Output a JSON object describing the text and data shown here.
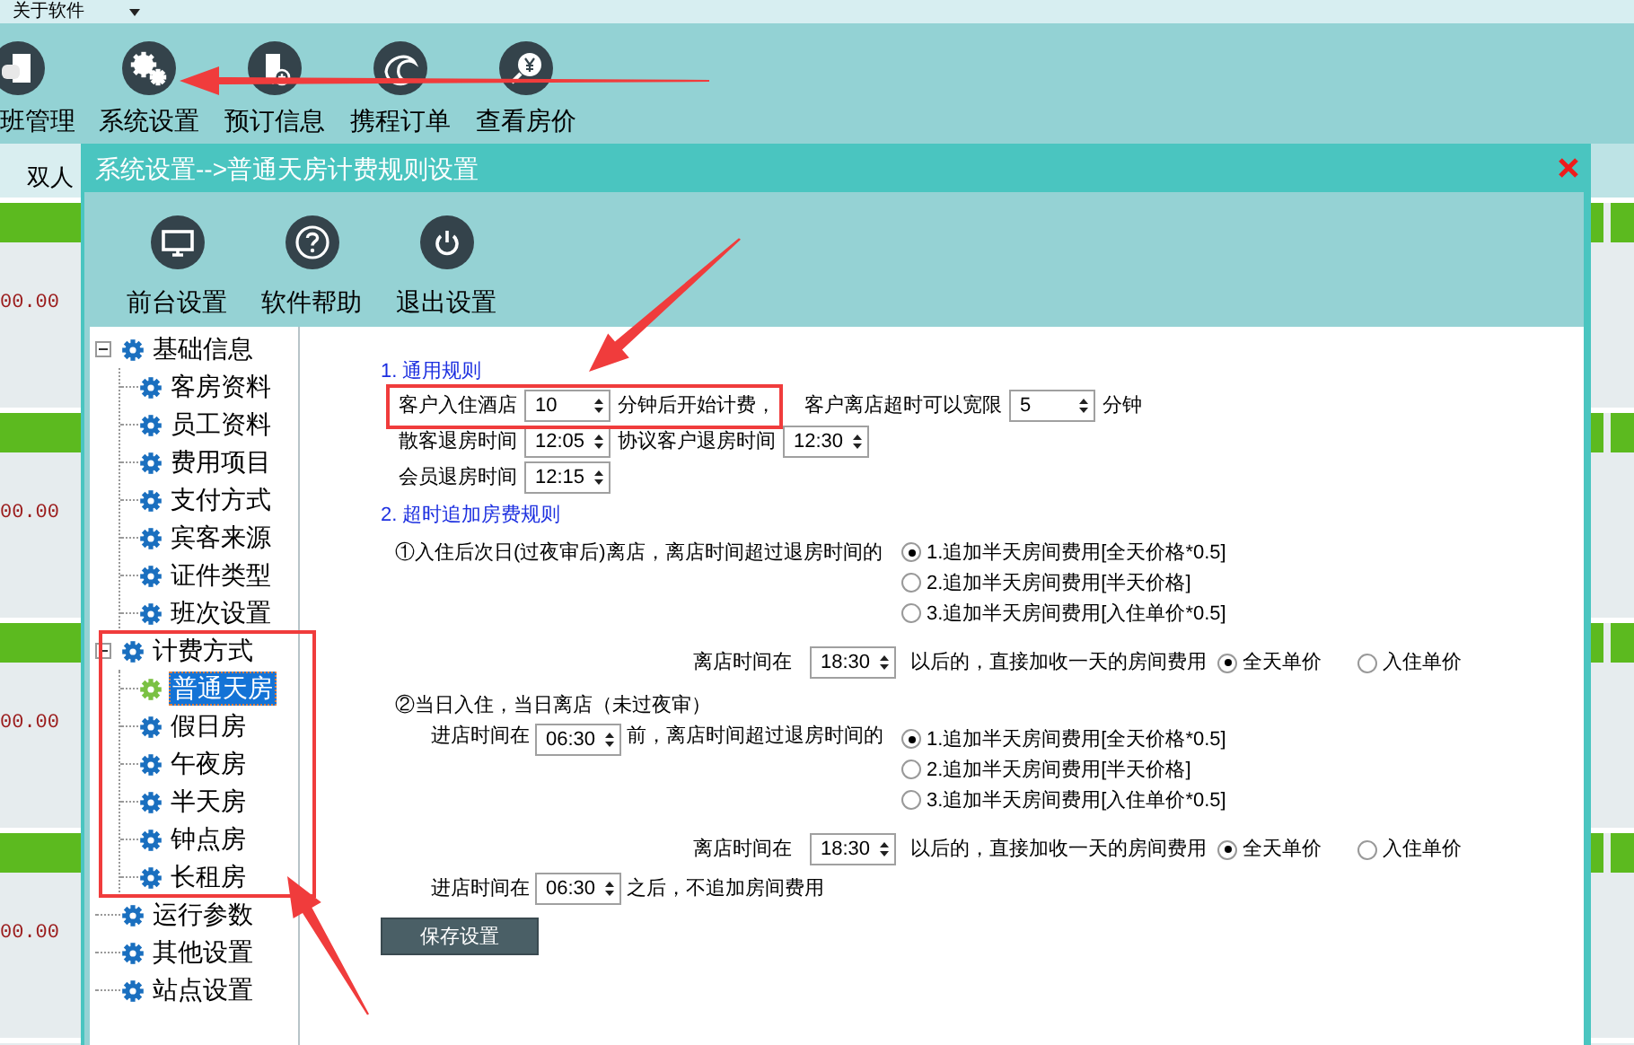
{
  "menu_bar": {
    "items": [
      {
        "label": "关于软件"
      }
    ]
  },
  "toolbar": [
    {
      "label": "班管理"
    },
    {
      "label": "系统设置"
    },
    {
      "label": "预订信息"
    },
    {
      "label": "携程订单"
    },
    {
      "label": "查看房价"
    }
  ],
  "room_view": {
    "tab": "双人",
    "cards": [
      {
        "price": "00.00"
      },
      {
        "price": "00.00"
      },
      {
        "price": "00.00"
      },
      {
        "price": "00.00"
      }
    ]
  },
  "dialog": {
    "title": "系统设置-->普通天房计费规则设置",
    "toolbar": [
      {
        "label": "前台设置"
      },
      {
        "label": "软件帮助"
      },
      {
        "label": "退出设置"
      }
    ],
    "tree": [
      {
        "label": "基础信息",
        "selected": false,
        "expanded": true,
        "children": [
          {
            "label": "客房资料",
            "selected": false
          },
          {
            "label": "员工资料",
            "selected": false
          },
          {
            "label": "费用项目",
            "selected": false
          },
          {
            "label": "支付方式",
            "selected": false
          },
          {
            "label": "宾客来源",
            "selected": false
          },
          {
            "label": "证件类型",
            "selected": false
          },
          {
            "label": "班次设置",
            "selected": false
          }
        ]
      },
      {
        "label": "计费方式",
        "selected": false,
        "expanded": true,
        "children": [
          {
            "label": "普通天房",
            "selected": true
          },
          {
            "label": "假日房",
            "selected": false
          },
          {
            "label": "午夜房",
            "selected": false
          },
          {
            "label": "半天房",
            "selected": false
          },
          {
            "label": "钟点房",
            "selected": false
          },
          {
            "label": "长租房",
            "selected": false
          }
        ]
      },
      {
        "label": "运行参数",
        "selected": false
      },
      {
        "label": "其他设置",
        "selected": false
      },
      {
        "label": "站点设置",
        "selected": false
      }
    ],
    "form": {
      "general": {
        "heading": "1. 通用规则",
        "rows": [
          [
            {
              "kind": "text",
              "text": "客户入住酒店"
            },
            {
              "kind": "spinner",
              "value": "10"
            },
            {
              "kind": "text",
              "text": "分钟后开始计费，"
            },
            {
              "kind": "text",
              "text": "客户离店超时可以宽限"
            },
            {
              "kind": "spinner",
              "value": "5"
            },
            {
              "kind": "text",
              "text": "分钟"
            }
          ],
          [
            {
              "kind": "text",
              "text": "散客退房时间"
            },
            {
              "kind": "spinner",
              "value": "12:05"
            },
            {
              "kind": "text",
              "text": "协议客户退房时间"
            },
            {
              "kind": "spinner",
              "value": "12:30"
            }
          ],
          [
            {
              "kind": "text",
              "text": "会员退房时间"
            },
            {
              "kind": "spinner",
              "value": "12:15"
            }
          ]
        ]
      },
      "overtime": {
        "heading": "2. 超时追加房费规则",
        "cases": [
          {
            "title": "①入住后次日(过夜审后)离店，离店时间超过退房时间的",
            "options": [
              {
                "label": "1.追加半天房间费用[全天价格*0.5]",
                "selected": true
              },
              {
                "label": "2.追加半天房间费用[半天价格]",
                "selected": false
              },
              {
                "label": "3.追加半天房间费用[入住单价*0.5]",
                "selected": false
              }
            ],
            "late_rule": {
              "label": "离店时间在",
              "value": "18:30",
              "suffix": "以后的，直接加收一天的房间费用",
              "options": [
                {
                  "label": "全天单价",
                  "selected": true
                },
                {
                  "label": "入住单价",
                  "selected": false
                }
              ]
            }
          },
          {
            "title": "②当日入住，当日离店（未过夜审）",
            "condition": {
              "label": "进店时间在",
              "value": "06:30",
              "suffix": "前，离店时间超过退房时间的"
            },
            "options": [
              {
                "label": "1.追加半天房间费用[全天价格*0.5]",
                "selected": true
              },
              {
                "label": "2.追加半天房间费用[半天价格]",
                "selected": false
              },
              {
                "label": "3.追加半天房间费用[入住单价*0.5]",
                "selected": false
              }
            ],
            "late_rule": {
              "label": "离店时间在",
              "value": "18:30",
              "suffix": "以后的，直接加收一天的房间费用",
              "options": [
                {
                  "label": "全天单价",
                  "selected": true
                },
                {
                  "label": "入住单价",
                  "selected": false
                }
              ]
            },
            "after": {
              "label": "进店时间在",
              "value": "06:30",
              "suffix": "之后，不追加房间费用"
            }
          }
        ]
      },
      "save_button": "保存设置"
    }
  }
}
